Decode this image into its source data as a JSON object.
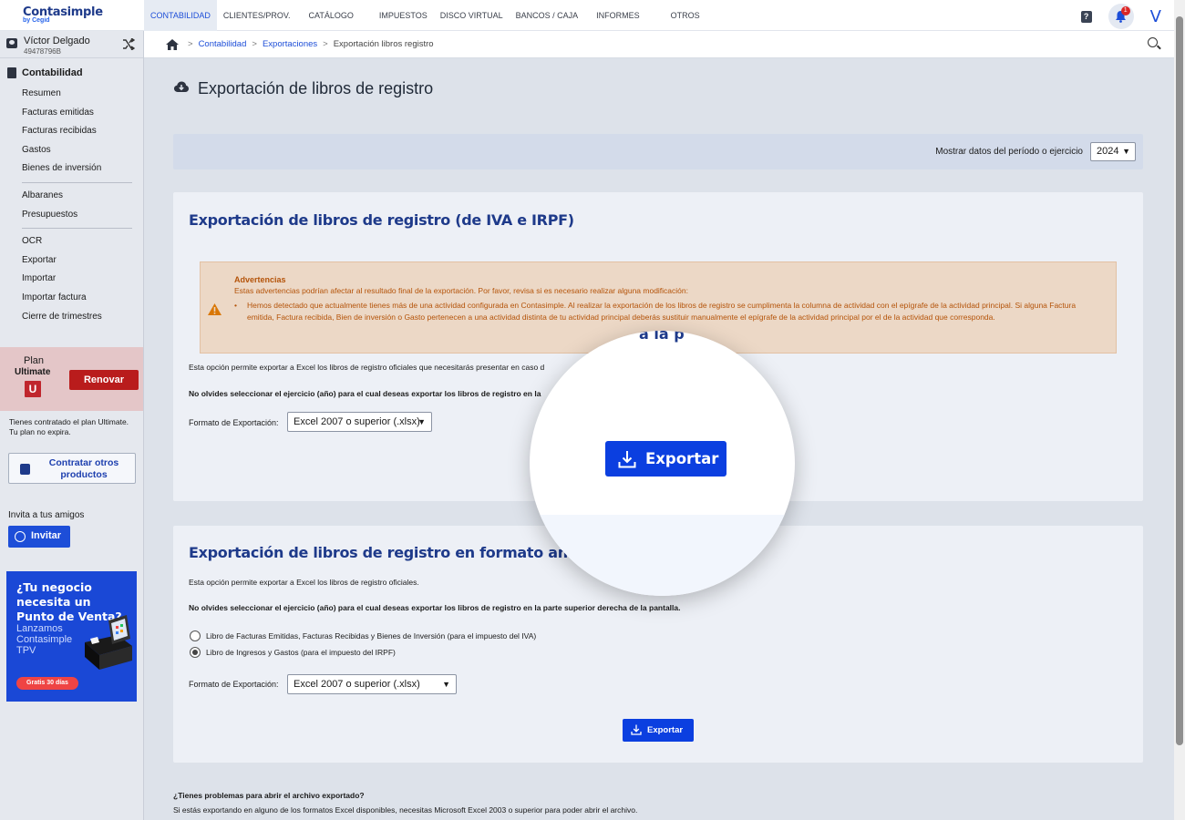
{
  "brand": {
    "name": "Contasimple",
    "by": "by Cegid"
  },
  "nav": [
    "CONTABILIDAD",
    "CLIENTES/PROV.",
    "CATÁLOGO",
    "IMPUESTOS",
    "DISCO VIRTUAL",
    "BANCOS / CAJA",
    "INFORMES",
    "OTROS"
  ],
  "topbar": {
    "notification_count": "1",
    "user_initial": "V",
    "help": "?"
  },
  "user": {
    "name": "Víctor Delgado",
    "id": "49478796B"
  },
  "sidebar": {
    "section": "Contabilidad",
    "group1": [
      "Resumen",
      "Facturas emitidas",
      "Facturas recibidas",
      "Gastos",
      "Bienes de inversión"
    ],
    "group2": [
      "Albaranes",
      "Presupuestos"
    ],
    "group3": [
      "OCR",
      "Exportar",
      "Importar",
      "Importar factura",
      "Cierre de trimestres"
    ],
    "plan_label": "Plan",
    "plan_name": "Ultimate",
    "plan_letter": "U",
    "renew": "Renovar",
    "plan_info_1": "Tienes contratado el plan Ultimate.",
    "plan_info_2": "Tu plan no expira.",
    "contract_btn": "Contratar otros productos",
    "invite_label": "Invita a tus amigos",
    "invite_btn": "Invitar",
    "ad_title": "¿Tu negocio necesita un Punto de Venta?",
    "ad_sub": "Lanzamos Contasimple TPV",
    "ad_cta": "Gratis 30 días"
  },
  "breadcrumb": {
    "l1": "Contabilidad",
    "l2": "Exportaciones",
    "current": "Exportación libros registro"
  },
  "page": {
    "title": "Exportación de libros de registro",
    "period_label": "Mostrar datos del período o ejercicio",
    "period_value": "2024"
  },
  "panel1": {
    "title": "Exportación de libros de registro (de IVA e IRPF)",
    "warn_title": "Advertencias",
    "warn_text": "Estas advertencias podrían afectar al resultado final de la exportación. Por favor, revisa si es necesario realizar alguna modificación:",
    "warn_item": "Hemos detectado que actualmente tienes más de una actividad configurada en Contasimple. Al realizar la exportación de los libros de registro se cumplimenta la columna de actividad con el epígrafe de la actividad principal. Si alguna Factura emitida, Factura recibida, Bien de inversión o Gasto pertenecen a una actividad distinta de tu actividad principal deberás sustituir manualmente el epígrafe de la actividad principal por el de la actividad que corresponda.",
    "desc": "Esta opción permite exportar a Excel los libros de registro oficiales que necesitarás presentar en caso d",
    "note": "No olvides seleccionar el ejercicio (año) para el cual deseas exportar los libros de registro en la",
    "format_label": "Formato de Exportación:",
    "format_value": "Excel 2007 o superior (.xlsx)",
    "export_btn": "Exportar",
    "mag_peek": "a la p"
  },
  "panel2": {
    "title": "Exportación de libros de registro en formato antiguo",
    "desc": "Esta opción permite exportar a Excel los libros de registro oficiales.",
    "note": "No olvides seleccionar el ejercicio (año) para el cual deseas exportar los libros de registro en la parte superior derecha de la pantalla.",
    "radio1": "Libro de Facturas Emitidas, Facturas Recibidas y Bienes de Inversión (para el impuesto del IVA)",
    "radio2": "Libro de Ingresos y Gastos (para el impuesto del IRPF)",
    "format_label": "Formato de Exportación:",
    "format_value": "Excel 2007 o superior (.xlsx)",
    "export_btn": "Exportar"
  },
  "help": {
    "title": "¿Tienes problemas para abrir el archivo exportado?",
    "text": "Si estás exportando en alguno de los formatos Excel disponibles, necesitas Microsoft Excel 2003 o superior para poder abrir el archivo."
  },
  "colors": {
    "primary": "#0b3fe0",
    "heading": "#1e3a8a",
    "warning": "#b45309",
    "renew": "#b91c1c"
  }
}
